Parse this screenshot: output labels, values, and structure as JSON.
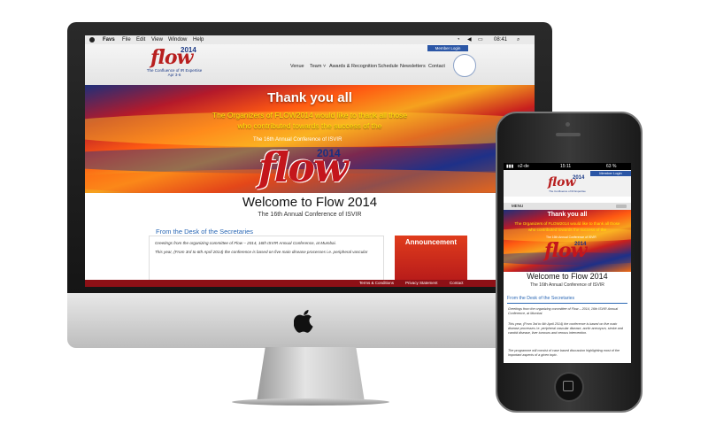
{
  "desktop": {
    "menubar": {
      "app": "Favs",
      "items": [
        "File",
        "Edit",
        "View",
        "Window",
        "Help"
      ],
      "clock": "08:41"
    },
    "header": {
      "member_login": "Member Login",
      "logo_text": "flow",
      "logo_year": "2014",
      "logo_tagline": "The Confluence of IR Expertise",
      "logo_dates": "Apr 3-6",
      "nav": [
        "Venue",
        "Team ˅",
        "Awards & Recognition",
        "Schedule",
        "Newsletters",
        "Contact"
      ]
    },
    "banner": {
      "title": "Thank you all",
      "line1": "The Organizers of FLOW2014 would like to thank all those",
      "line2": "who contributed towards the success of the",
      "sub": "The 16th Annual Conference of ISVIR",
      "logo_text": "flow",
      "logo_year": "2014"
    },
    "content": {
      "welcome": "Welcome to Flow 2014",
      "welcome_sub": "The 16th Annual Conference of ISVIR",
      "desk_heading": "From the Desk of the Secretaries",
      "para1": "Greetings from the organizing committee of Flow – 2014, 16th ISVIR Annual Conference, at Mumbai.",
      "para2": "This year, (From 3rd to 6th April 2014) the conference is based on five main disease processes i.e. peripheral vascular",
      "announcement": "Announcement"
    },
    "footer": [
      "Terms & Conditions",
      "Privacy Statement",
      "Contact"
    ]
  },
  "phone": {
    "status": {
      "carrier": "o2-de",
      "time": "15:11",
      "battery": "63 %"
    },
    "header": {
      "member_login": "Member Login",
      "logo_text": "flow",
      "logo_year": "2014",
      "logo_tagline": "The Confluence of IR Expertise",
      "menu": "MENU"
    },
    "banner": {
      "title": "Thank you all",
      "line1": "The Organizers of FLOW2014 would like to thank all those",
      "line2": "who contributed towards the success of the",
      "sub": "The 16th Annual Conference of ISVIR",
      "logo_text": "flow",
      "logo_year": "2014"
    },
    "content": {
      "welcome": "Welcome to Flow 2014",
      "welcome_sub": "The 16th Annual Conference of ISVIR",
      "desk_heading": "From the Desk of the Secretaries",
      "para1": "Greetings from the organizing committee of Flow – 2014, 16th ISVIR Annual Conference, at Mumbai.",
      "para2": "This year, (From 3rd to 6th April 2014) the conference is based on five main disease processes i.e. peripheral vascular disease, aortic aneurysm, stroke and carotid disease, liver tumours and venous intervention.",
      "para3": "The programme will consist of case based discussion highlighting most of the important aspects of a given topic."
    }
  },
  "colors": {
    "brand_blue": "#2b56a6",
    "brand_red": "#b81f1f",
    "heading_blue": "#2b68b5",
    "highlight_yellow": "#ffe10a"
  }
}
